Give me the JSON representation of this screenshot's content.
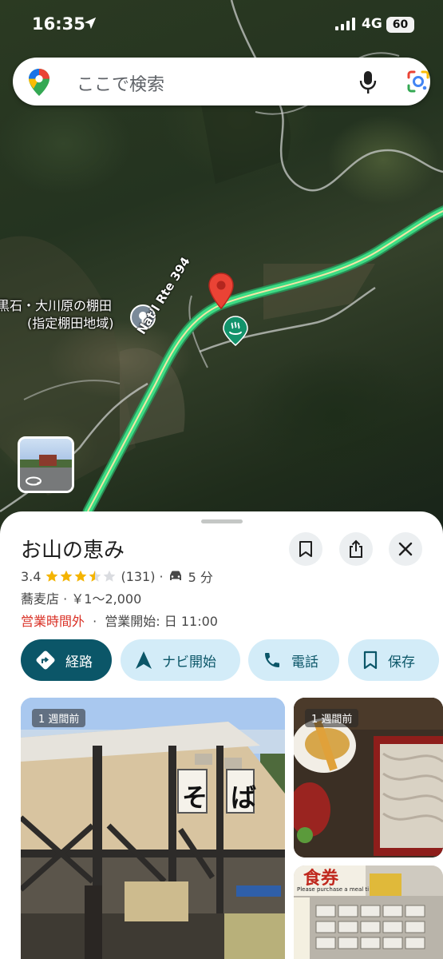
{
  "status_bar": {
    "time": "16:35",
    "network": "4G",
    "battery": "60"
  },
  "search": {
    "placeholder": "ここで検索"
  },
  "map": {
    "area_label_line1": "黒石・大川原の棚田",
    "area_label_line2": "(指定棚田地域)",
    "route_label": "Nat'l Rte 394"
  },
  "place": {
    "name": "お山の恵み",
    "rating": "3.4",
    "stars_filled": 3.5,
    "review_count": "(131)",
    "separator": "·",
    "drive_time": "5 分",
    "category": "蕎麦店 · ￥1～2,000",
    "hours_status": "営業時間外",
    "hours_separator": "·",
    "hours_next": "営業開始: 日 11:00"
  },
  "actions": {
    "directions": "経路",
    "start_nav": "ナビ開始",
    "call": "電話",
    "save": "保存"
  },
  "photos": [
    {
      "badge": "1 週間前",
      "sign_text_1": "そ",
      "sign_text_2": "ば"
    },
    {
      "badge": "1 週間前"
    },
    {
      "sign_text": "食券",
      "sub_text": "Please purchase a meal ticket"
    }
  ],
  "colors": {
    "primary": "#0b5668",
    "chip_bg": "#d3ecf8",
    "closed_red": "#d93025",
    "star": "#f4b400",
    "route_green": "#3ddc84",
    "pin_red": "#ea4335"
  }
}
